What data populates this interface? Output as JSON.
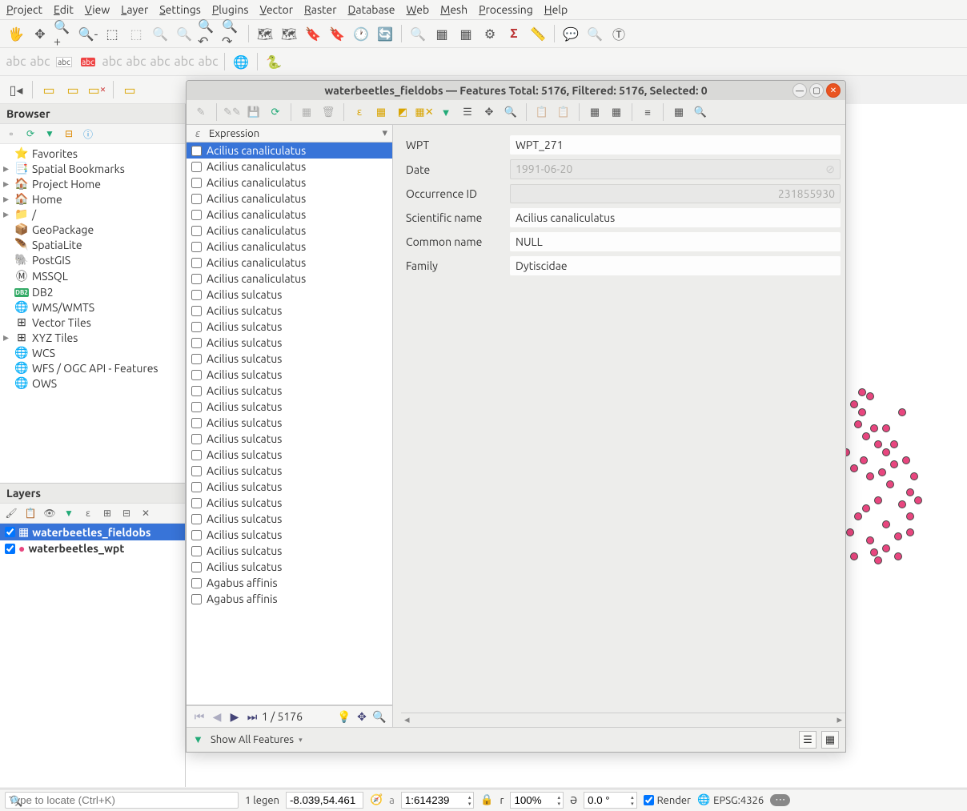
{
  "menu": {
    "items": [
      "Project",
      "Edit",
      "View",
      "Layer",
      "Settings",
      "Plugins",
      "Vector",
      "Raster",
      "Database",
      "Web",
      "Mesh",
      "Processing",
      "Help"
    ]
  },
  "browser": {
    "title": "Browser",
    "items": [
      {
        "icon": "⭐",
        "label": "Favorites",
        "expandable": false
      },
      {
        "icon": "📑",
        "label": "Spatial Bookmarks",
        "expandable": true
      },
      {
        "icon": "🏠",
        "label": "Project Home",
        "expandable": true,
        "green": true
      },
      {
        "icon": "🏠",
        "label": "Home",
        "expandable": true
      },
      {
        "icon": "📁",
        "label": "/",
        "expandable": true
      },
      {
        "icon": "📦",
        "label": "GeoPackage",
        "expandable": false,
        "orange": true
      },
      {
        "icon": "🪶",
        "label": "SpatiaLite",
        "expandable": false
      },
      {
        "icon": "🐘",
        "label": "PostGIS",
        "expandable": false
      },
      {
        "icon": "Ⓜ",
        "label": "MSSQL",
        "expandable": false
      },
      {
        "icon": "DB2",
        "label": "DB2",
        "expandable": false,
        "db2": true
      },
      {
        "icon": "🌐",
        "label": "WMS/WMTS",
        "expandable": false
      },
      {
        "icon": "⊞",
        "label": "Vector Tiles",
        "expandable": false
      },
      {
        "icon": "⊞",
        "label": "XYZ Tiles",
        "expandable": true
      },
      {
        "icon": "🌐",
        "label": "WCS",
        "expandable": false
      },
      {
        "icon": "🌐",
        "label": "WFS / OGC API - Features",
        "expandable": false
      },
      {
        "icon": "🌐",
        "label": "OWS",
        "expandable": false
      }
    ]
  },
  "layers": {
    "title": "Layers",
    "items": [
      {
        "name": "waterbeetles_fieldobs",
        "checked": true,
        "selected": true,
        "symbol": "▦"
      },
      {
        "name": "waterbeetles_wpt",
        "checked": true,
        "selected": false,
        "symbol": "●",
        "color": "#e8467f"
      }
    ]
  },
  "attr": {
    "title": "waterbeetles_fieldobs — Features Total: 5176, Filtered: 5176, Selected: 0",
    "expression_label": "Expression",
    "features": [
      {
        "label": "Acilius canaliculatus",
        "selected": true
      },
      {
        "label": "Acilius canaliculatus"
      },
      {
        "label": "Acilius canaliculatus"
      },
      {
        "label": "Acilius canaliculatus"
      },
      {
        "label": "Acilius canaliculatus"
      },
      {
        "label": "Acilius canaliculatus"
      },
      {
        "label": "Acilius canaliculatus"
      },
      {
        "label": "Acilius canaliculatus"
      },
      {
        "label": "Acilius canaliculatus"
      },
      {
        "label": "Acilius sulcatus"
      },
      {
        "label": "Acilius sulcatus"
      },
      {
        "label": "Acilius sulcatus"
      },
      {
        "label": "Acilius sulcatus"
      },
      {
        "label": "Acilius sulcatus"
      },
      {
        "label": "Acilius sulcatus"
      },
      {
        "label": "Acilius sulcatus"
      },
      {
        "label": "Acilius sulcatus"
      },
      {
        "label": "Acilius sulcatus"
      },
      {
        "label": "Acilius sulcatus"
      },
      {
        "label": "Acilius sulcatus"
      },
      {
        "label": "Acilius sulcatus"
      },
      {
        "label": "Acilius sulcatus"
      },
      {
        "label": "Acilius sulcatus"
      },
      {
        "label": "Acilius sulcatus"
      },
      {
        "label": "Acilius sulcatus"
      },
      {
        "label": "Acilius sulcatus"
      },
      {
        "label": "Acilius sulcatus"
      },
      {
        "label": "Agabus affinis"
      },
      {
        "label": "Agabus affinis"
      }
    ],
    "nav": {
      "pos_text": "1 / 5176"
    },
    "form": {
      "wpt_label": "WPT",
      "wpt_val": "WPT_271",
      "date_label": "Date",
      "date_val": "1991-06-20",
      "occ_label": "Occurrence ID",
      "occ_val": "231855930",
      "sci_label": "Scientific name",
      "sci_val": "Acilius canaliculatus",
      "common_label": "Common name",
      "common_val": "NULL",
      "family_label": "Family",
      "family_val": "Dytiscidae"
    },
    "footer_label": "Show All Features"
  },
  "status": {
    "locator_placeholder": "Type to locate (Ctrl+K)",
    "legend": "1 legen",
    "coord": "-8.039,54.461",
    "scale": "1:614239",
    "mag": "100%",
    "rot": "0.0 °",
    "render": "Render",
    "crs": "EPSG:4326"
  }
}
